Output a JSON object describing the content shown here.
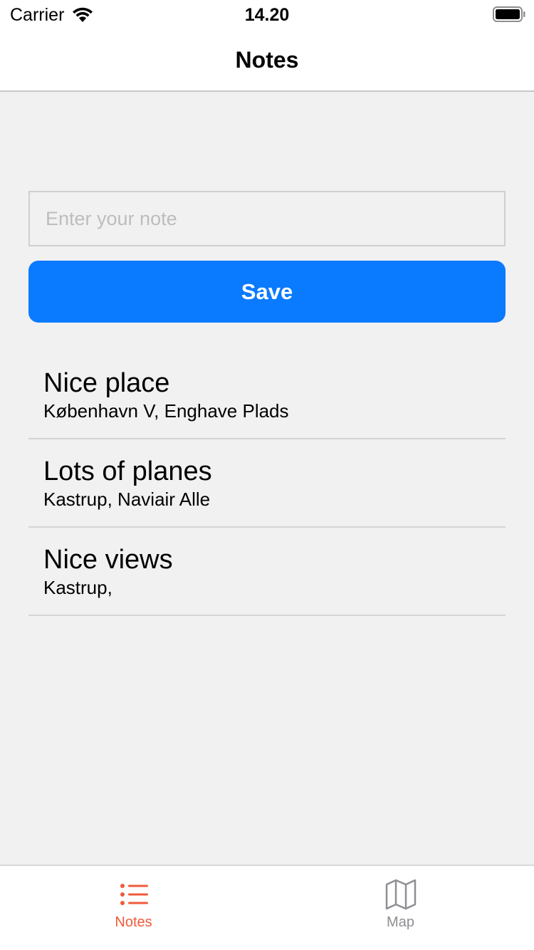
{
  "status_bar": {
    "carrier": "Carrier",
    "time": "14.20",
    "icons": [
      "wifi-icon",
      "battery-icon"
    ]
  },
  "nav": {
    "title": "Notes"
  },
  "form": {
    "input_placeholder": "Enter your note",
    "input_value": "",
    "save_label": "Save"
  },
  "notes": [
    {
      "title": "Nice place",
      "subtitle": "København V, Enghave Plads"
    },
    {
      "title": "Lots of planes",
      "subtitle": "Kastrup, Naviair Alle"
    },
    {
      "title": "Nice views",
      "subtitle": "Kastrup,"
    }
  ],
  "tabs": [
    {
      "label": "Notes",
      "icon": "list-icon",
      "selected": true
    },
    {
      "label": "Map",
      "icon": "map-icon",
      "selected": false
    }
  ],
  "colors": {
    "accent": "#0a7aff",
    "tab_active": "#f05a3a",
    "tab_inactive": "#8e8e93",
    "background": "#f1f1f1"
  }
}
